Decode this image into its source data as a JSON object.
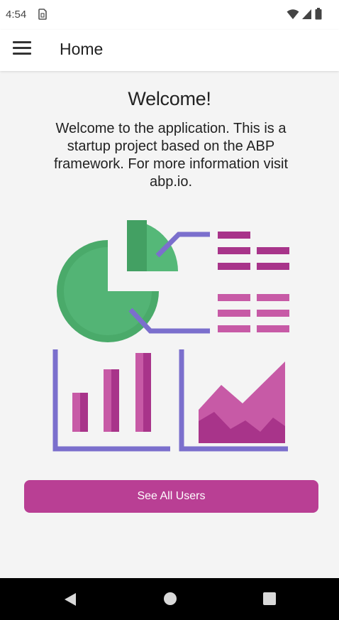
{
  "status_bar": {
    "time": "4:54",
    "icons": [
      "sim-card-icon",
      "wifi-icon",
      "cellular-signal-icon",
      "battery-icon"
    ]
  },
  "app_bar": {
    "menu_icon": "hamburger-menu-icon",
    "title": "Home"
  },
  "main": {
    "heading": "Welcome!",
    "body": "Welcome to the application. This is a startup project based on the ABP framework. For more information visit abp.io.",
    "illustration": "dashboard-analytics-illustration",
    "button_label": "See All Users"
  },
  "nav_bar": {
    "icons": [
      "back-icon",
      "home-icon",
      "recents-icon"
    ]
  },
  "colors": {
    "accent": "#b93f94",
    "green": "#4caf6e",
    "purple": "#7b6fcd",
    "magenta": "#a8348a",
    "pink": "#c75aa6",
    "background": "#f4f4f4"
  }
}
